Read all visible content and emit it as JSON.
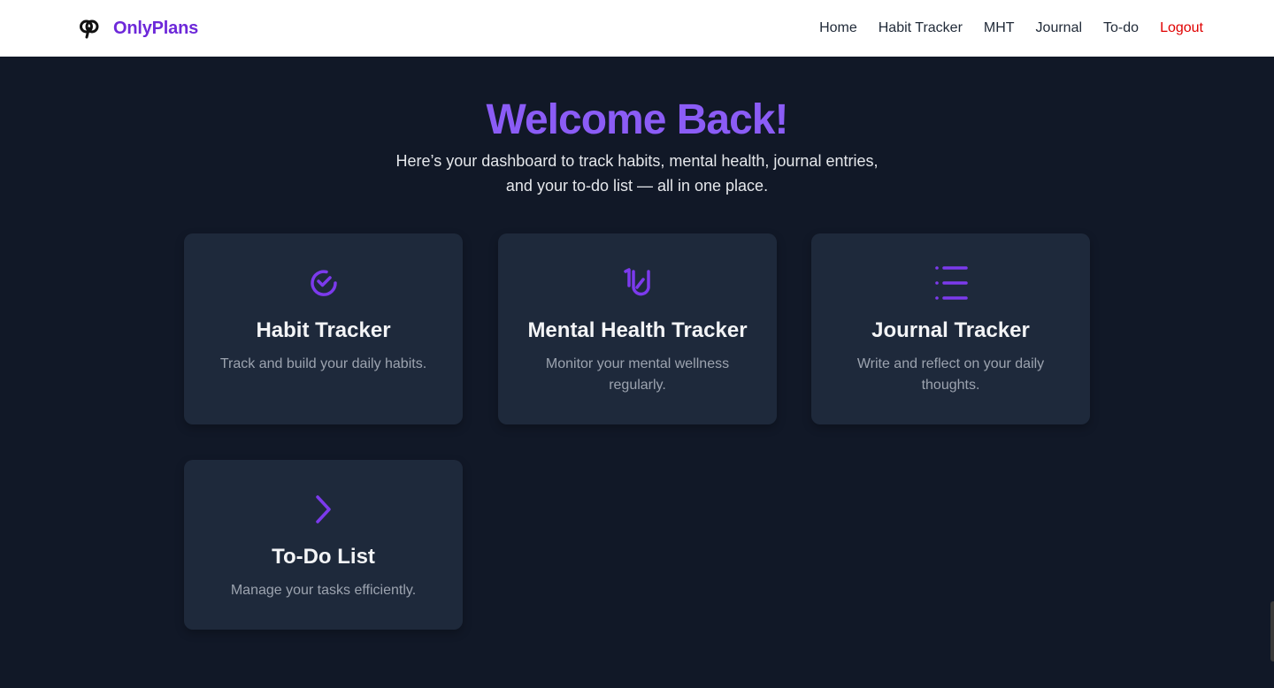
{
  "brand": {
    "name": "OnlyPlans",
    "logo_icon": "brand-logo-icon"
  },
  "nav": {
    "items": [
      {
        "label": "Home"
      },
      {
        "label": "Habit Tracker"
      },
      {
        "label": "MHT"
      },
      {
        "label": "Journal"
      },
      {
        "label": "To-do"
      },
      {
        "label": "Logout"
      }
    ]
  },
  "hero": {
    "title": "Welcome Back!",
    "subtitle_line1": "Here’s your dashboard to track habits, mental health, journal entries,",
    "subtitle_line2": "and your to-do list — all in one place."
  },
  "cards": [
    {
      "title": "Habit Tracker",
      "description": "Track and build your daily habits.",
      "icon": "progress-check-icon"
    },
    {
      "title": "Mental Health Tracker",
      "description": "Monitor your mental wellness regularly.",
      "icon": "mental-health-icon"
    },
    {
      "title": "Journal Tracker",
      "description": "Write and reflect on your daily thoughts.",
      "icon": "list-icon"
    },
    {
      "title": "To-Do List",
      "description": "Manage your tasks efficiently.",
      "icon": "chevron-right-icon"
    }
  ],
  "colors": {
    "accent": "#8b5cf6",
    "brand": "#6d28d9",
    "logout": "#e00000",
    "background": "#111827",
    "card": "#1e293b"
  }
}
